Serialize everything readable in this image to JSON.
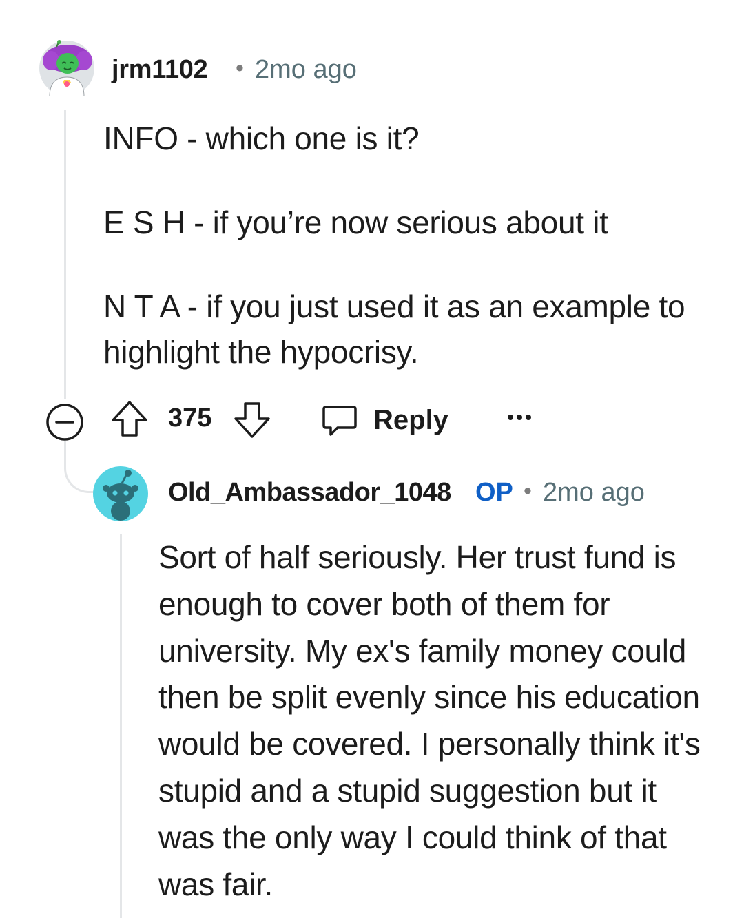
{
  "comment": {
    "author": "jrm1102",
    "separator": "•",
    "timestamp": "2mo ago",
    "paragraphs": [
      "INFO - which one is it?",
      "E S H - if you’re now serious about it",
      "N T A - if you just used it as an example to highlight the hypocrisy."
    ],
    "score": "375",
    "reply_label": "Reply",
    "icons": {
      "collapse": "collapse-icon",
      "upvote": "upvote-icon",
      "downvote": "downvote-icon",
      "reply": "reply-icon",
      "more": "more-icon"
    }
  },
  "reply": {
    "author": "Old_Ambassador_1048",
    "op_badge": "OP",
    "separator": "•",
    "timestamp": "2mo ago",
    "body": "Sort of half seriously. Her trust fund is enough to cover both of them for university. My ex's family money could then be split evenly since his education would be covered. I personally think it's stupid and a stupid suggestion but it was the only way I could think of that was fair."
  },
  "colors": {
    "op_badge": "#0f5fc6",
    "meta_text": "#576f76",
    "thread_line": "#e4e6e8",
    "avatar_2_bg": "#54d3e2"
  }
}
